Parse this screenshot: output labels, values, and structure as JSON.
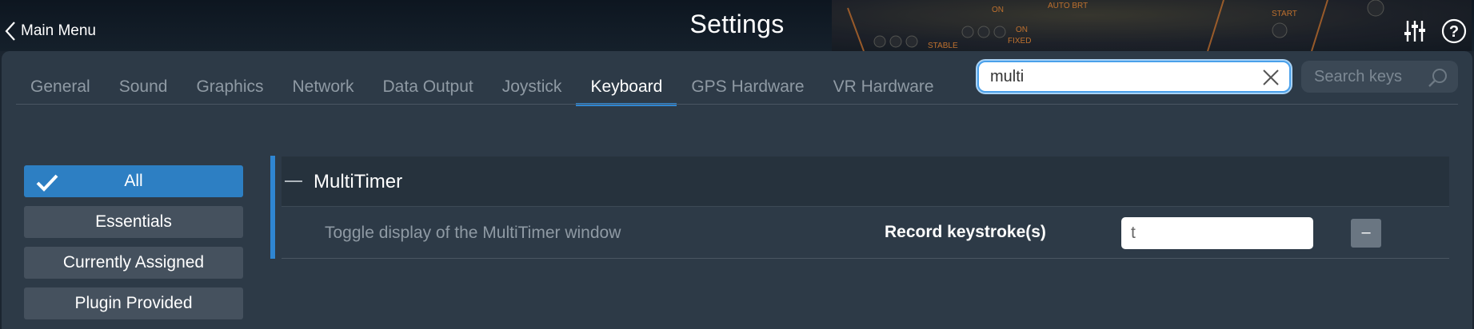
{
  "header": {
    "back_label": "Main Menu",
    "title": "Settings",
    "icons": [
      "sliders-icon",
      "help-icon"
    ]
  },
  "tabs": [
    {
      "label": "General",
      "active": false
    },
    {
      "label": "Sound",
      "active": false
    },
    {
      "label": "Graphics",
      "active": false
    },
    {
      "label": "Network",
      "active": false
    },
    {
      "label": "Data Output",
      "active": false
    },
    {
      "label": "Joystick",
      "active": false
    },
    {
      "label": "Keyboard",
      "active": true
    },
    {
      "label": "GPS Hardware",
      "active": false
    },
    {
      "label": "VR Hardware",
      "active": false
    }
  ],
  "search": {
    "filter_value": "multi",
    "keys_placeholder": "Search keys"
  },
  "filters": [
    {
      "label": "All",
      "selected": true
    },
    {
      "label": "Essentials",
      "selected": false
    },
    {
      "label": "Currently Assigned",
      "selected": false
    },
    {
      "label": "Plugin Provided",
      "selected": false
    }
  ],
  "group": {
    "title": "MultiTimer",
    "commands": [
      {
        "description": "Toggle display of the MultiTimer window",
        "record_label": "Record keystroke(s)",
        "key": "t",
        "remove_label": "–"
      }
    ]
  },
  "colors": {
    "accent": "#2f86d2",
    "panel": "#2d3a47",
    "background": "#1b2530"
  }
}
